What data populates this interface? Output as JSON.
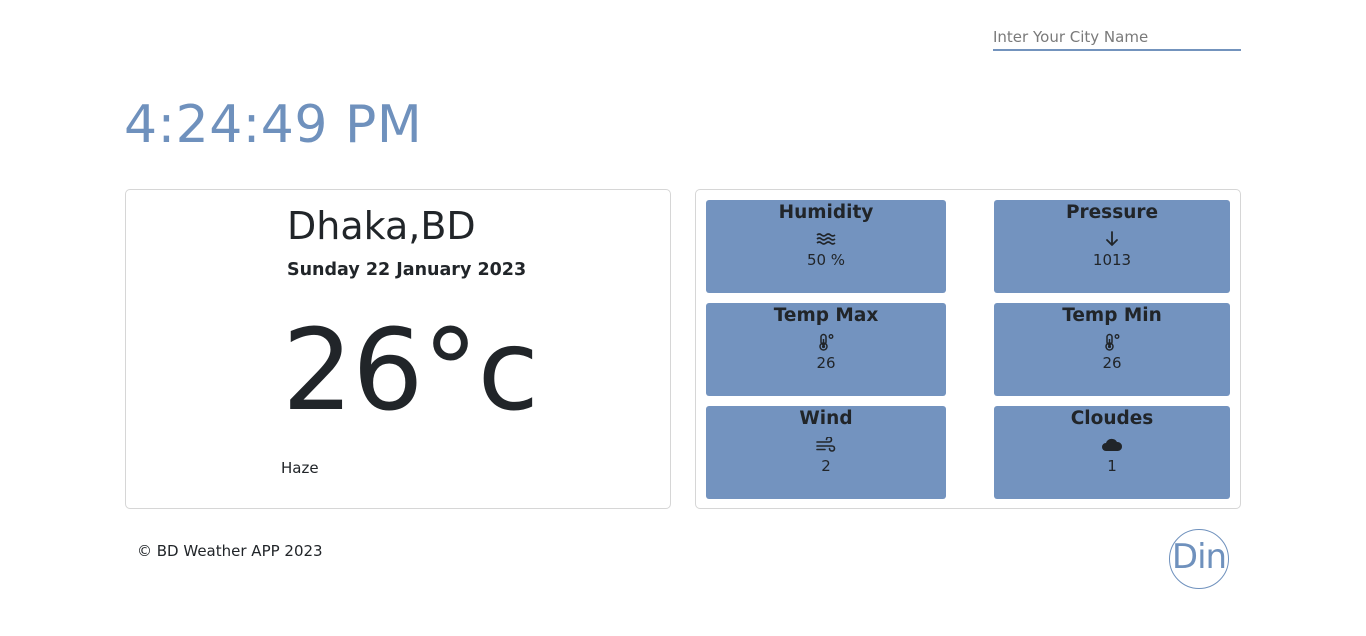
{
  "search": {
    "placeholder": "Inter Your City Name",
    "value": ""
  },
  "clock": {
    "time": "4:24:49 PM"
  },
  "weather": {
    "location": "Dhaka,BD",
    "date": "Sunday 22 January 2023",
    "temperature": "26°c",
    "condition": "Haze"
  },
  "stats": {
    "humidity": {
      "label": "Humidity",
      "icon": "waves-icon",
      "value": "50 %"
    },
    "pressure": {
      "label": "Pressure",
      "icon": "arrow-down-icon",
      "value": "1013"
    },
    "temp_max": {
      "label": "Temp Max",
      "icon": "thermometer-icon",
      "value": "26"
    },
    "temp_min": {
      "label": "Temp Min",
      "icon": "thermometer-icon",
      "value": "26"
    },
    "wind": {
      "label": "Wind",
      "icon": "wind-icon",
      "value": "2"
    },
    "clouds": {
      "label": "Cloudes",
      "icon": "cloud-icon",
      "value": "1"
    }
  },
  "footer": {
    "copyright": "© BD Weather APP 2023"
  },
  "logo": {
    "text": "Din"
  },
  "colors": {
    "accent": "#6f91bd",
    "tile_background": "#7393bf",
    "text": "#212529",
    "card_border": "#d6d6d6"
  }
}
